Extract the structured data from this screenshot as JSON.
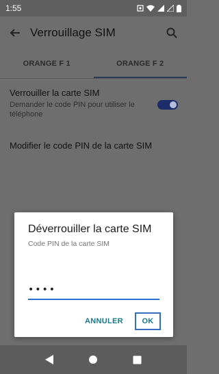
{
  "status_bar": {
    "time": "1:55"
  },
  "app_bar": {
    "title": "Verrouillage SIM"
  },
  "tabs": [
    {
      "label": "ORANGE F 1",
      "active": false
    },
    {
      "label": "ORANGE F 2",
      "active": true
    }
  ],
  "settings": {
    "lock_title": "Verrouiller la carte SIM",
    "lock_subtitle": "Demander le code PIN pour utiliser le téléphone",
    "lock_enabled": true,
    "modify_label": "Modifier le code PIN de la carte SIM"
  },
  "dialog": {
    "title": "Déverrouiller la carte SIM",
    "subtitle": "Code PIN de la carte SIM",
    "pin_value": "••••",
    "cancel_label": "ANNULER",
    "ok_label": "OK"
  },
  "colors": {
    "accent": "#167a8a",
    "input_underline": "#2d6fd2",
    "toggle_on": "#1d2c6a"
  },
  "icons": [
    "back-arrow-icon",
    "search-icon",
    "nav-back-icon",
    "nav-home-icon",
    "nav-recents-icon"
  ]
}
